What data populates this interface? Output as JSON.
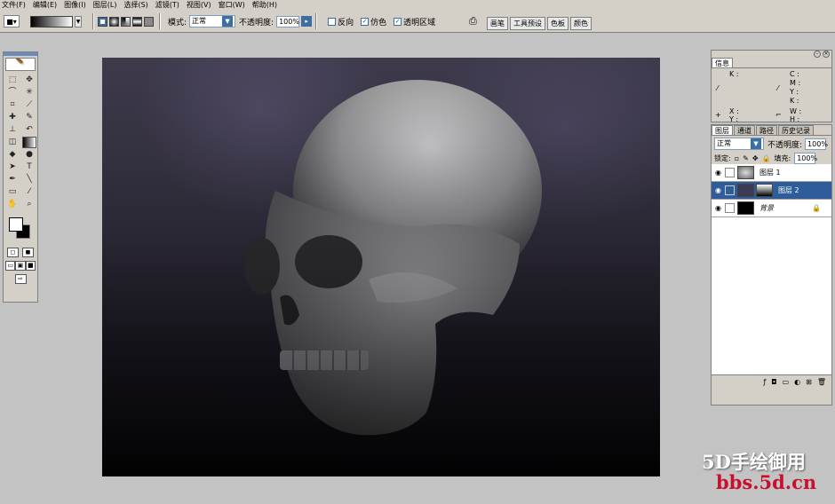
{
  "menu": [
    "文件(F)",
    "编辑(E)",
    "图像(I)",
    "图层(L)",
    "选择(S)",
    "滤镜(T)",
    "视图(V)",
    "窗口(W)",
    "帮助(H)"
  ],
  "options": {
    "mode_label": "模式:",
    "mode_value": "正常",
    "opacity_label": "不透明度:",
    "opacity_value": "100%",
    "reverse": "反向",
    "dither": "仿色",
    "transparency": "透明区域",
    "wells": [
      "画笔",
      "工具预设",
      "色板",
      "颜色"
    ]
  },
  "info": {
    "title": "信息",
    "k_label": "K :",
    "c": "C :",
    "m": "M :",
    "y": "Y :",
    "k": "K :",
    "x": "X :",
    "y2": "Y :",
    "w": "W :",
    "h": "H :"
  },
  "layers": {
    "tabs": [
      "图层",
      "通道",
      "路径",
      "历史记录"
    ],
    "blend_mode": "正常",
    "opacity_label": "不透明度:",
    "opacity_value": "100%",
    "lock_label": "锁定:",
    "fill_label": "填充:",
    "fill_value": "100%",
    "items": [
      {
        "name": "图层 1",
        "selected": false
      },
      {
        "name": "图层 2",
        "selected": true
      },
      {
        "name": "背景",
        "selected": false
      }
    ]
  },
  "watermark": {
    "line1": "5D手绘御用",
    "line2": "bbs.5d.cn"
  },
  "colors": {
    "selected_layer": "#2f5d9a",
    "watermark_red": "#c8102e"
  }
}
